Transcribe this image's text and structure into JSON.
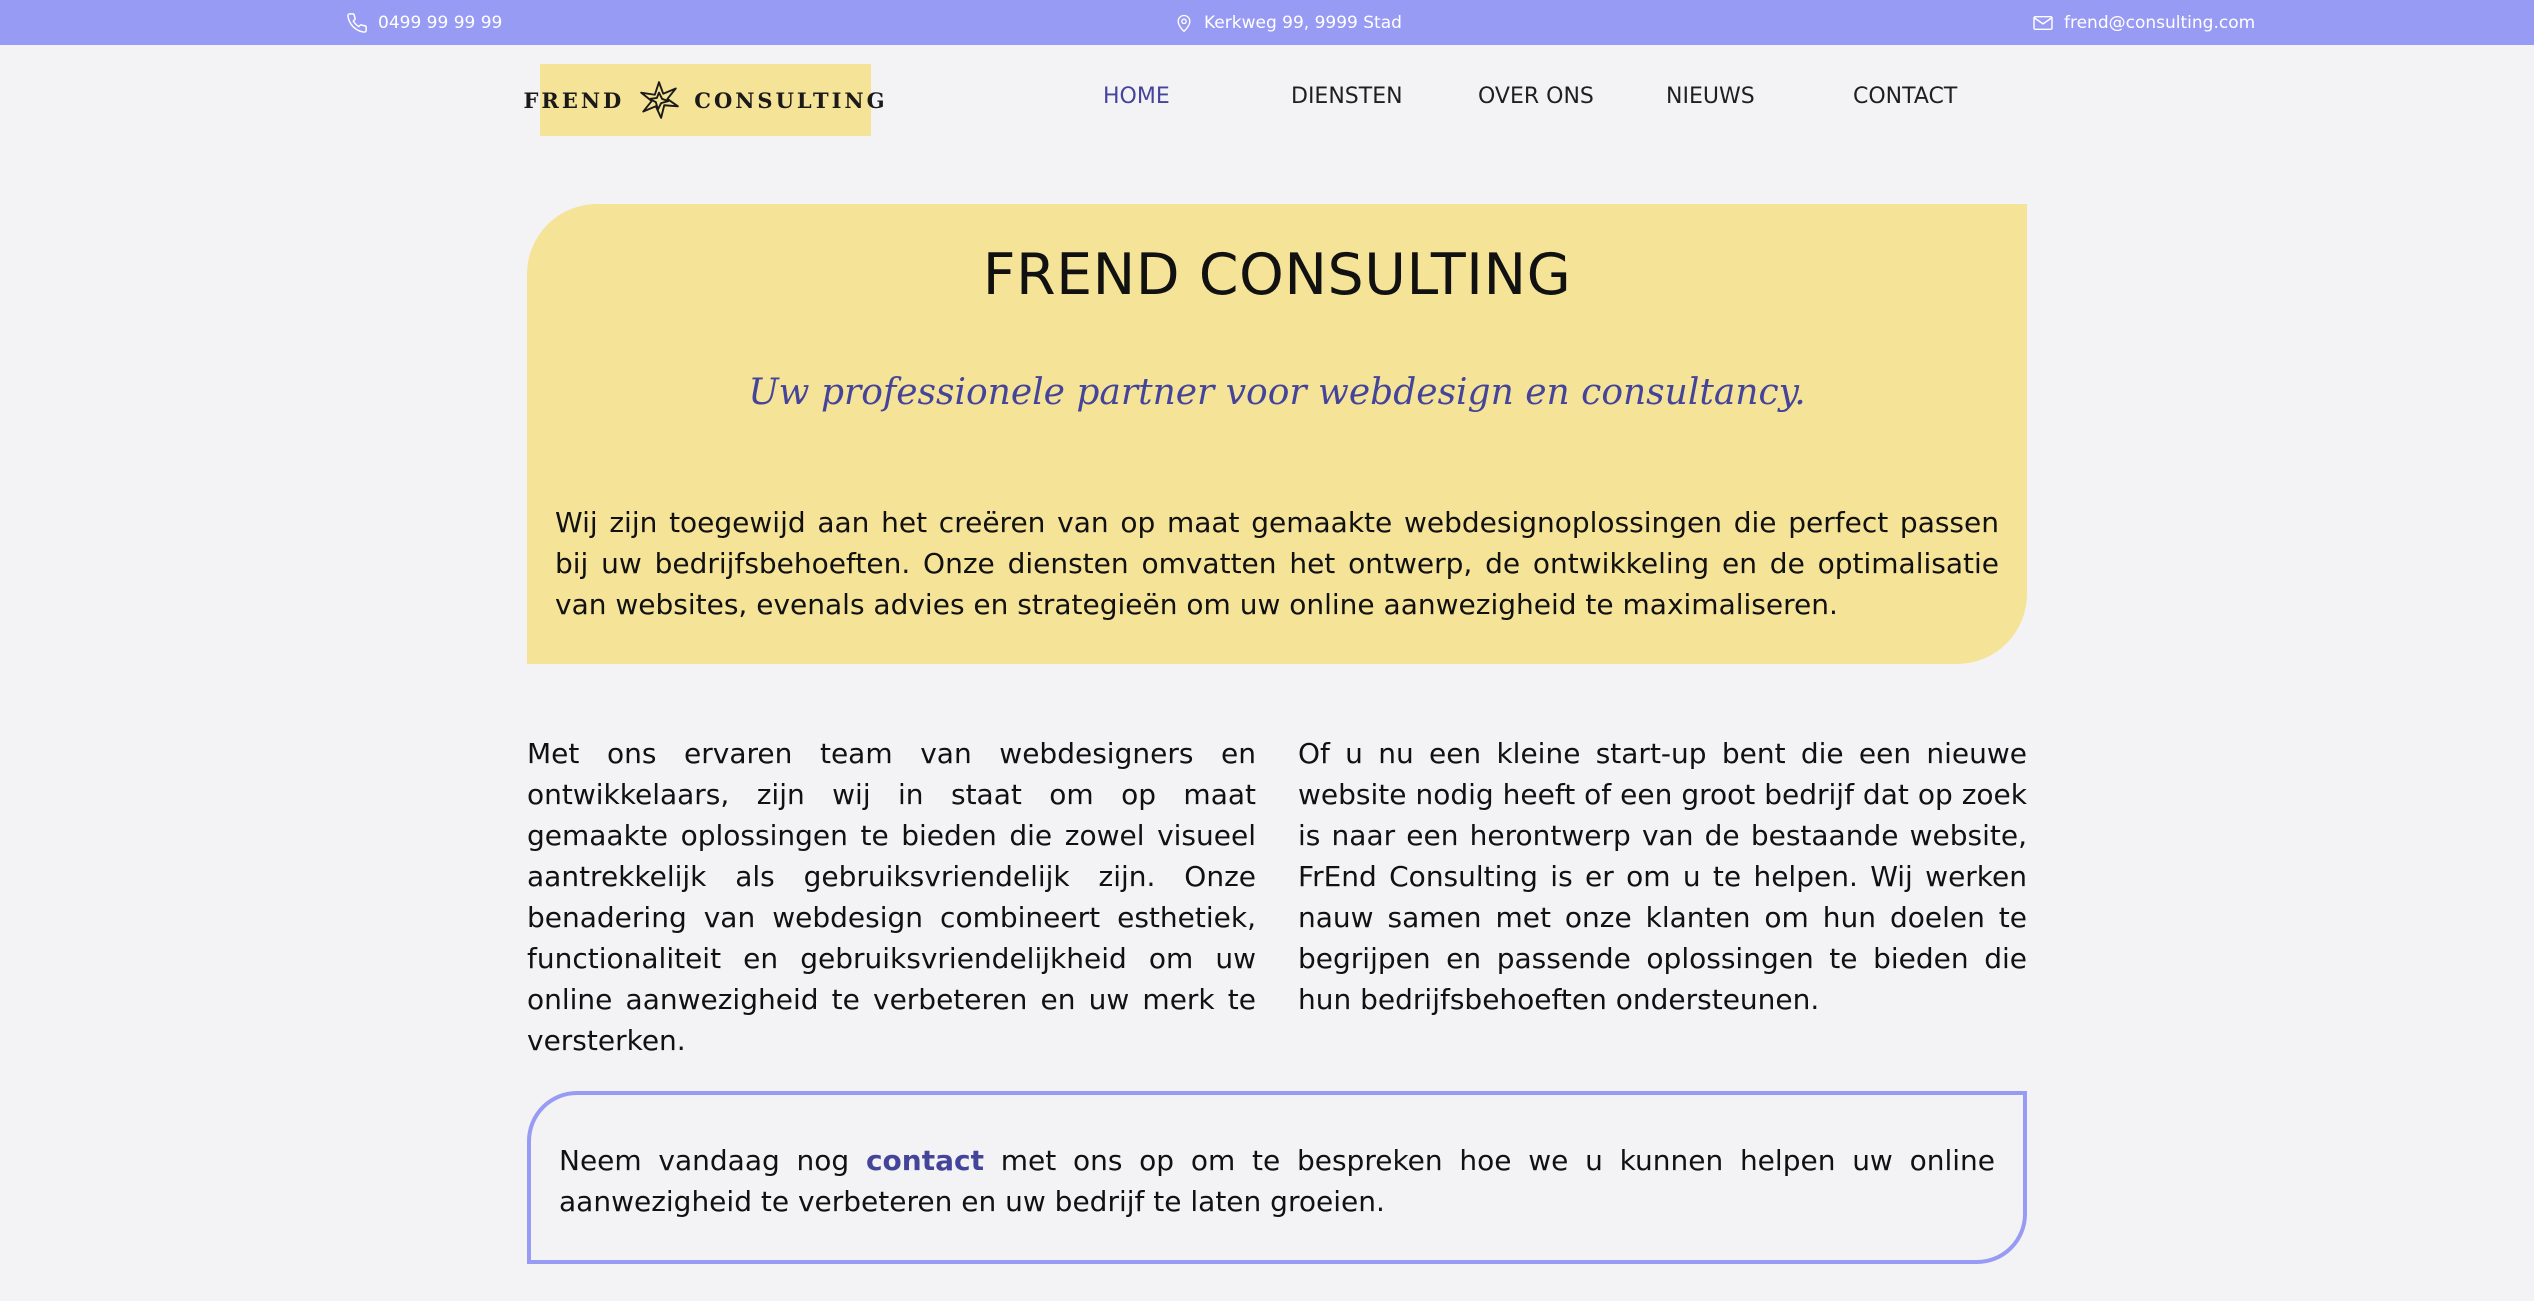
{
  "topbar": {
    "phone": "0499 99 99 99",
    "address": "Kerkweg 99, 9999 Stad",
    "email": "frend@consulting.com",
    "background": "#989bf3",
    "icons": [
      "phone-icon",
      "location-pin-icon",
      "mail-icon"
    ]
  },
  "logo": {
    "left": "FREND",
    "right": "CONSULTING",
    "icon": "logo-starburst-icon",
    "background": "#f5e398"
  },
  "nav": {
    "items": [
      {
        "label": "HOME",
        "active": true
      },
      {
        "label": "DIENSTEN",
        "active": false
      },
      {
        "label": "OVER ONS",
        "active": false
      },
      {
        "label": "NIEUWS",
        "active": false
      },
      {
        "label": "CONTACT",
        "active": false
      }
    ],
    "active_color": "#44449b"
  },
  "hero": {
    "title": "FREND CONSULTING",
    "tagline": "Uw professionele partner voor webdesign en consultancy.",
    "intro": "Wij zijn toegewijd aan het creëren van op maat gemaakte webdesignoplossingen die perfect passen bij uw bedrijfsbehoeften. Onze diensten omvatten het ontwerp, de ontwikkeling en de optimalisatie van websites, evenals advies en strategieën om uw online aanwezigheid te maximaliseren."
  },
  "columns": {
    "left": "Met ons ervaren team van webdesigners en ontwikkelaars, zijn wij in staat om op maat gemaakte oplossingen te bieden die zowel visueel aantrekkelijk als gebruiksvriendelijk zijn. Onze benadering van webdesign combineert esthetiek, functionaliteit en gebruiksvriendelijkheid om uw online aanwezigheid te verbeteren en uw merk te versterken.",
    "right": "Of u nu een kleine start-up bent die een nieuwe website nodig heeft of een groot bedrijf dat op zoek is naar een herontwerp van de bestaande website, FrEnd Consulting is er om u te helpen. Wij werken nauw samen met onze klanten om hun doelen te begrijpen en passende oplossingen te bieden die hun bedrijfsbehoeften ondersteunen."
  },
  "cta": {
    "before": "Neem vandaag nog ",
    "link": "contact",
    "after": " met ons op om te bespreken hoe we u kunnen helpen uw online aanwezigheid te verbeteren en uw bedrijf te laten groeien.",
    "border_color": "#989bf3"
  }
}
